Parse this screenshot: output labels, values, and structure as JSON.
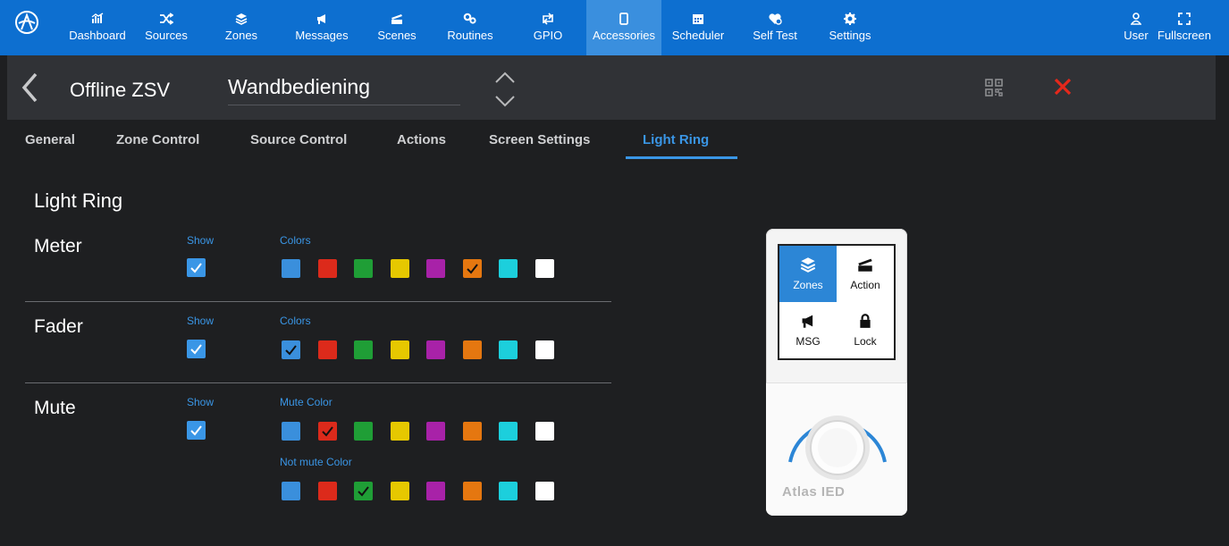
{
  "nav": {
    "items": [
      {
        "label": "Dashboard",
        "icon": "dashboard-icon"
      },
      {
        "label": "Sources",
        "icon": "shuffle-icon"
      },
      {
        "label": "Zones",
        "icon": "layers-icon"
      },
      {
        "label": "Messages",
        "icon": "megaphone-icon"
      },
      {
        "label": "Scenes",
        "icon": "clapper-icon"
      },
      {
        "label": "Routines",
        "icon": "gears-icon"
      },
      {
        "label": "GPIO",
        "icon": "swap-icon"
      },
      {
        "label": "Accessories",
        "icon": "tablet-icon"
      },
      {
        "label": "Scheduler",
        "icon": "calendar-icon"
      },
      {
        "label": "Self Test",
        "icon": "heart-pulse-icon"
      },
      {
        "label": "Settings",
        "icon": "gear-icon"
      }
    ],
    "active": "Accessories",
    "user_label": "User",
    "fullscreen_label": "Fullscreen"
  },
  "header": {
    "title": "Offline ZSV",
    "name_value": "Wandbediening"
  },
  "tabs": [
    "General",
    "Zone Control",
    "Source Control",
    "Actions",
    "Screen Settings",
    "Light Ring"
  ],
  "active_tab": "Light Ring",
  "section_title": "Light Ring",
  "palette": [
    "#3a8fdc",
    "#dc2a1b",
    "#1f9e36",
    "#e6c800",
    "#a822a8",
    "#e57710",
    "#1ccfdc",
    "#ffffff"
  ],
  "rows": [
    {
      "label": "Meter",
      "show_label": "Show",
      "show": true,
      "colors_label": "Colors",
      "selected": 5
    },
    {
      "label": "Fader",
      "show_label": "Show",
      "show": true,
      "colors_label": "Colors",
      "selected": 0
    },
    {
      "label": "Mute",
      "show_label": "Show",
      "show": true,
      "colors_label": "Mute Color",
      "selected": 1,
      "colors2_label": "Not mute Color",
      "selected2": 2
    }
  ],
  "device": {
    "tiles": [
      {
        "label": "Zones",
        "icon": "layers-icon",
        "selected": true
      },
      {
        "label": "Action",
        "icon": "clapper-icon",
        "selected": false
      },
      {
        "label": "MSG",
        "icon": "megaphone-icon",
        "selected": false
      },
      {
        "label": "Lock",
        "icon": "lock-icon",
        "selected": false
      }
    ],
    "brand": "Atlas IED"
  },
  "colors": {
    "accent": "#3a96e6",
    "nav_bg": "#0d6fd0",
    "close": "#e5281b"
  }
}
